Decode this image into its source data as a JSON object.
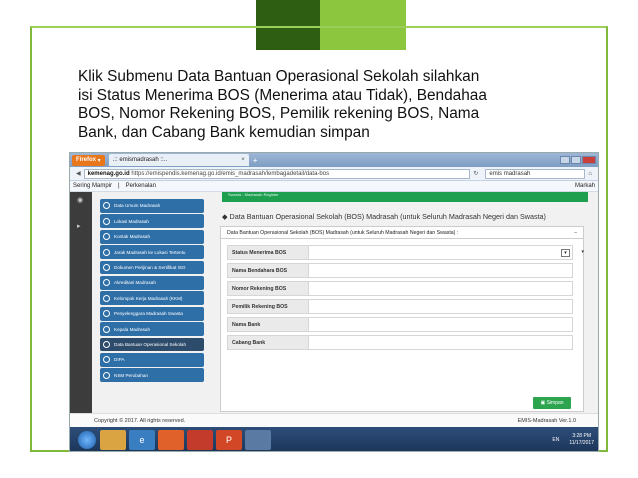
{
  "slide": {
    "lines": [
      "Klik Submenu Data Bantuan Operasional Sekolah silahkan",
      "isi Status Menerima BOS (Menerima atau Tidak), Bendahaa",
      "BOS, Nomor Rekening BOS, Pemilik rekening BOS, Nama",
      "Bank, dan Cabang Bank kemudian simpan"
    ]
  },
  "browser": {
    "firefox_label": "Firefox",
    "tab_title": ".:: emismadrasah ::..",
    "tab_close": "×",
    "new_tab": "+",
    "url_domain": "kemenag.go.id",
    "url_full": "https://emispendis.kemenag.go.id/emis_madrasah/lembagadetail/data-bos",
    "search_text": "emis madrasah",
    "bookmarks_left": "Sering Mampir",
    "bookmarks_mid": "Perkenalan",
    "bookmarks_right": "Markah"
  },
  "sidebar": {
    "items": [
      "Data Umum Madrasah",
      "Lokasi Madrasah",
      "Kontak Madrasah",
      "Jarak Madrasah ke Lokasi Tertentu",
      "Dokumen Perijinan & Sertifikat ISO",
      "Akreditasi Madrasah",
      "Kelompok Kerja Madrasah (KKM)",
      "Penyelenggara Madrasah Swasta",
      "Kepala Madrasah",
      "Data Bantuan Operasional Sekolah",
      "DIPA",
      "NSM Perubahan"
    ]
  },
  "main": {
    "green_bar_text": "Swasta - Madrasah Register",
    "heading": "Data Bantuan Operasional Sekolah (BOS) Madrasah (untuk Seluruh Madrasah Negeri dan Swasta)",
    "panel_title": "Data Bantuan Operasional Sekolah (BOS) Madrasah (untuk Seluruh Madrasah Negeri dan Swasta) :",
    "panel_minimize": "−",
    "fields": [
      {
        "label": "Status Menerima BOS",
        "value": ""
      },
      {
        "label": "Nama Bendahara BOS",
        "value": ""
      },
      {
        "label": "Nomor Rekening BOS",
        "value": ""
      },
      {
        "label": "Pemilik Rekening BOS",
        "value": ""
      },
      {
        "label": "Nama Bank",
        "value": ""
      },
      {
        "label": "Cabang Bank",
        "value": ""
      }
    ],
    "save_label": "Simpan"
  },
  "footer": {
    "copyright": "Copyright © 2017. All rights reserved.",
    "version": "EMIS-Madrasah Ver.1.0"
  },
  "taskbar": {
    "lang": "EN",
    "time": "3:28 PM",
    "date": "11/17/2017"
  }
}
